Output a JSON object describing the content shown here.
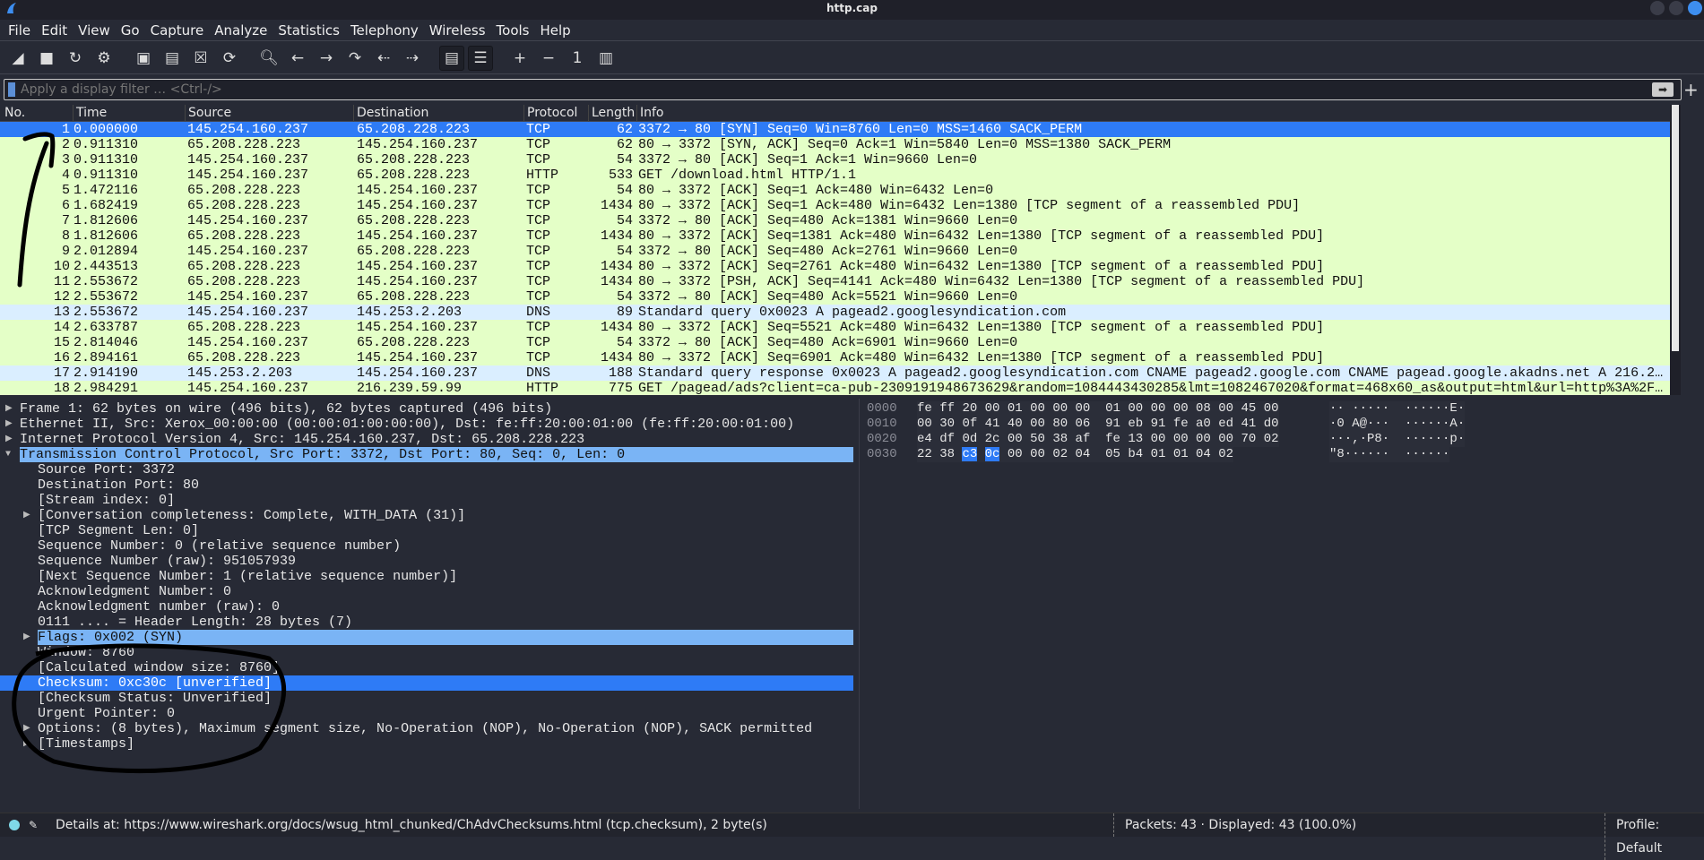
{
  "window": {
    "title": "http.cap"
  },
  "menu": [
    "File",
    "Edit",
    "View",
    "Go",
    "Capture",
    "Analyze",
    "Statistics",
    "Telephony",
    "Wireless",
    "Tools",
    "Help"
  ],
  "toolbar": [
    {
      "icon": "start-capture-icon",
      "glyph": "◢"
    },
    {
      "icon": "stop-capture-icon",
      "glyph": "■"
    },
    {
      "icon": "restart-capture-icon",
      "glyph": "↻"
    },
    {
      "icon": "capture-options-icon",
      "glyph": "⚙"
    },
    {
      "icon": "open-file-icon",
      "glyph": "▣"
    },
    {
      "icon": "file-icon",
      "glyph": "▤"
    },
    {
      "icon": "close-file-icon",
      "glyph": "☒"
    },
    {
      "icon": "reload-file-icon",
      "glyph": "⟳"
    },
    {
      "icon": "search-icon",
      "glyph": "🔍︎"
    },
    {
      "icon": "back-icon",
      "glyph": "←"
    },
    {
      "icon": "forward-icon",
      "glyph": "→"
    },
    {
      "icon": "go-to-packet-icon",
      "glyph": "↷"
    },
    {
      "icon": "first-packet-icon",
      "glyph": "⇠"
    },
    {
      "icon": "last-packet-icon",
      "glyph": "⇢"
    },
    {
      "icon": "autoscroll-icon",
      "glyph": "▤"
    },
    {
      "icon": "colorize-icon",
      "glyph": "☰"
    },
    {
      "icon": "zoom-in-icon",
      "glyph": "+"
    },
    {
      "icon": "zoom-out-icon",
      "glyph": "−"
    },
    {
      "icon": "normal-size-icon",
      "glyph": "1"
    },
    {
      "icon": "resize-columns-icon",
      "glyph": "▥"
    }
  ],
  "filter": {
    "placeholder": "Apply a display filter … <Ctrl-/>",
    "value": ""
  },
  "packet_list": {
    "columns": [
      "No.",
      "Time",
      "Source",
      "Destination",
      "Protocol",
      "Length",
      "Info"
    ],
    "selected": 1,
    "rows": [
      [
        "1",
        "0.000000",
        "145.254.160.237",
        "65.208.228.223",
        "TCP",
        "62",
        "3372 → 80 [SYN] Seq=0 Win=8760 Len=0 MSS=1460 SACK_PERM"
      ],
      [
        "2",
        "0.911310",
        "65.208.228.223",
        "145.254.160.237",
        "TCP",
        "62",
        "80 → 3372 [SYN, ACK] Seq=0 Ack=1 Win=5840 Len=0 MSS=1380 SACK_PERM"
      ],
      [
        "3",
        "0.911310",
        "145.254.160.237",
        "65.208.228.223",
        "TCP",
        "54",
        "3372 → 80 [ACK] Seq=1 Ack=1 Win=9660 Len=0"
      ],
      [
        "4",
        "0.911310",
        "145.254.160.237",
        "65.208.228.223",
        "HTTP",
        "533",
        "GET /download.html HTTP/1.1"
      ],
      [
        "5",
        "1.472116",
        "65.208.228.223",
        "145.254.160.237",
        "TCP",
        "54",
        "80 → 3372 [ACK] Seq=1 Ack=480 Win=6432 Len=0"
      ],
      [
        "6",
        "1.682419",
        "65.208.228.223",
        "145.254.160.237",
        "TCP",
        "1434",
        "80 → 3372 [ACK] Seq=1 Ack=480 Win=6432 Len=1380 [TCP segment of a reassembled PDU]"
      ],
      [
        "7",
        "1.812606",
        "145.254.160.237",
        "65.208.228.223",
        "TCP",
        "54",
        "3372 → 80 [ACK] Seq=480 Ack=1381 Win=9660 Len=0"
      ],
      [
        "8",
        "1.812606",
        "65.208.228.223",
        "145.254.160.237",
        "TCP",
        "1434",
        "80 → 3372 [ACK] Seq=1381 Ack=480 Win=6432 Len=1380 [TCP segment of a reassembled PDU]"
      ],
      [
        "9",
        "2.012894",
        "145.254.160.237",
        "65.208.228.223",
        "TCP",
        "54",
        "3372 → 80 [ACK] Seq=480 Ack=2761 Win=9660 Len=0"
      ],
      [
        "10",
        "2.443513",
        "65.208.228.223",
        "145.254.160.237",
        "TCP",
        "1434",
        "80 → 3372 [ACK] Seq=2761 Ack=480 Win=6432 Len=1380 [TCP segment of a reassembled PDU]"
      ],
      [
        "11",
        "2.553672",
        "65.208.228.223",
        "145.254.160.237",
        "TCP",
        "1434",
        "80 → 3372 [PSH, ACK] Seq=4141 Ack=480 Win=6432 Len=1380 [TCP segment of a reassembled PDU]"
      ],
      [
        "12",
        "2.553672",
        "145.254.160.237",
        "65.208.228.223",
        "TCP",
        "54",
        "3372 → 80 [ACK] Seq=480 Ack=5521 Win=9660 Len=0"
      ],
      [
        "13",
        "2.553672",
        "145.254.160.237",
        "145.253.2.203",
        "DNS",
        "89",
        "Standard query 0x0023 A pagead2.googlesyndication.com"
      ],
      [
        "14",
        "2.633787",
        "65.208.228.223",
        "145.254.160.237",
        "TCP",
        "1434",
        "80 → 3372 [ACK] Seq=5521 Ack=480 Win=6432 Len=1380 [TCP segment of a reassembled PDU]"
      ],
      [
        "15",
        "2.814046",
        "145.254.160.237",
        "65.208.228.223",
        "TCP",
        "54",
        "3372 → 80 [ACK] Seq=480 Ack=6901 Win=9660 Len=0"
      ],
      [
        "16",
        "2.894161",
        "65.208.228.223",
        "145.254.160.237",
        "TCP",
        "1434",
        "80 → 3372 [ACK] Seq=6901 Ack=480 Win=6432 Len=1380 [TCP segment of a reassembled PDU]"
      ],
      [
        "17",
        "2.914190",
        "145.253.2.203",
        "145.254.160.237",
        "DNS",
        "188",
        "Standard query response 0x0023 A pagead2.googlesyndication.com CNAME pagead2.google.com CNAME pagead.google.akadns.net A 216.2…"
      ],
      [
        "18",
        "2.984291",
        "145.254.160.237",
        "216.239.59.99",
        "HTTP",
        "775",
        "GET /pagead/ads?client=ca-pub-2309191948673629&random=1084443430285&lmt=1082467020&format=468x60_as&output=html&url=http%3A%2F…"
      ]
    ]
  },
  "details": [
    {
      "text": "Frame 1: 62 bytes on wire (496 bits), 62 bytes captured (496 bits)",
      "level": 0,
      "arrow": "collapsed"
    },
    {
      "text": "Ethernet II, Src: Xerox_00:00:00 (00:00:01:00:00:00), Dst: fe:ff:20:00:01:00 (fe:ff:20:00:01:00)",
      "level": 0,
      "arrow": "collapsed"
    },
    {
      "text": "Internet Protocol Version 4, Src: 145.254.160.237, Dst: 65.208.228.223",
      "level": 0,
      "arrow": "collapsed"
    },
    {
      "text": "Transmission Control Protocol, Src Port: 3372, Dst Port: 80, Seq: 0, Len: 0",
      "level": 0,
      "arrow": "expanded",
      "state": "highlight"
    },
    {
      "text": "Source Port: 3372",
      "level": 1
    },
    {
      "text": "Destination Port: 80",
      "level": 1
    },
    {
      "text": "[Stream index: 0]",
      "level": 1
    },
    {
      "text": "[Conversation completeness: Complete, WITH_DATA (31)]",
      "level": 1,
      "arrow": "collapsed"
    },
    {
      "text": "[TCP Segment Len: 0]",
      "level": 1
    },
    {
      "text": "Sequence Number: 0    (relative sequence number)",
      "level": 1
    },
    {
      "text": "Sequence Number (raw): 951057939",
      "level": 1
    },
    {
      "text": "[Next Sequence Number: 1    (relative sequence number)]",
      "level": 1
    },
    {
      "text": "Acknowledgment Number: 0",
      "level": 1
    },
    {
      "text": "Acknowledgment number (raw): 0",
      "level": 1
    },
    {
      "text": "0111 .... = Header Length: 28 bytes (7)",
      "level": 1
    },
    {
      "text": "Flags: 0x002 (SYN)",
      "level": 1,
      "arrow": "collapsed",
      "state": "highlight"
    },
    {
      "text": "Window: 8760",
      "level": 1
    },
    {
      "text": "[Calculated window size: 8760]",
      "level": 1
    },
    {
      "text": "Checksum: 0xc30c [unverified]",
      "level": 1,
      "state": "selected"
    },
    {
      "text": "[Checksum Status: Unverified]",
      "level": 1
    },
    {
      "text": "Urgent Pointer: 0",
      "level": 1
    },
    {
      "text": "Options: (8 bytes), Maximum segment size, No-Operation (NOP), No-Operation (NOP), SACK permitted",
      "level": 1,
      "arrow": "collapsed"
    },
    {
      "text": "[Timestamps]",
      "level": 1,
      "arrow": "collapsed"
    }
  ],
  "hex": [
    {
      "offset": "0000",
      "bytes": [
        "fe",
        "ff",
        "20",
        "00",
        "01",
        "00",
        "00",
        "00",
        "01",
        "00",
        "00",
        "00",
        "08",
        "00",
        "45",
        "00"
      ],
      "ascii": "·· ·····  ······E·"
    },
    {
      "offset": "0010",
      "bytes": [
        "00",
        "30",
        "0f",
        "41",
        "40",
        "00",
        "80",
        "06",
        "91",
        "eb",
        "91",
        "fe",
        "a0",
        "ed",
        "41",
        "d0"
      ],
      "ascii": "·0 A@···  ······A·"
    },
    {
      "offset": "0020",
      "bytes": [
        "e4",
        "df",
        "0d",
        "2c",
        "00",
        "50",
        "38",
        "af",
        "fe",
        "13",
        "00",
        "00",
        "00",
        "00",
        "70",
        "02"
      ],
      "ascii": "···,·P8·  ······p·"
    },
    {
      "offset": "0030",
      "bytes": [
        "22",
        "38",
        "c3",
        "0c",
        "00",
        "00",
        "02",
        "04",
        "05",
        "b4",
        "01",
        "01",
        "04",
        "02"
      ],
      "ascii": "\"8······  ······",
      "selected_bytes": [
        2,
        3
      ]
    }
  ],
  "status": {
    "details": "Details at: https://www.wireshark.org/docs/wsug_html_chunked/ChAdvChecksums.html (tcp.checksum), 2 byte(s)",
    "packets": "Packets: 43 · Displayed: 43 (100.0%)",
    "profile": "Profile: Default"
  },
  "colors": {
    "tcp_row": "#e4ffc7",
    "dns_row": "#daeeff",
    "selected": "#2e7bf6",
    "highlight": "#7ab4f5",
    "background": "#272a35"
  }
}
